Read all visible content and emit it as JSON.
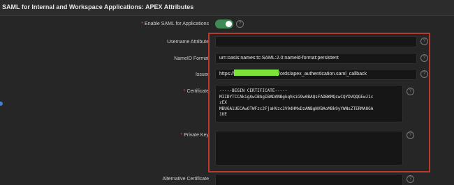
{
  "header": {
    "title": "SAML for Internal and Workspace Applications: APEX Attributes"
  },
  "form": {
    "enable_saml": {
      "label": "Enable SAML for Applications",
      "required_mark": "*",
      "state": "on"
    },
    "username_attribute": {
      "label": "Username Attribute",
      "value": ""
    },
    "nameid_format": {
      "label": "NameID Format",
      "value": "urn:oasis:names:tc:SAML:2.0:nameid-format:persistent"
    },
    "issuer": {
      "label": "Issuer",
      "prefix": "https://",
      "suffix": "/ords/apex_authentication.saml_callback"
    },
    "certificate": {
      "label": "Certificate",
      "required_mark": "*",
      "lines": [
        "-----BEGIN CERTIFICATE-----",
        "MIIDYTCCAkigAwIBAgIBADANBgkqhkiG9w0BAQsFADBKMQswCQYDVQQGEwJ1c",
        "zEX",
        "MBUGA1UECAwOTWFzc2FjaHVzc2V0dHMxDzANBgNVBAoMBk9yYWNsZTERMA8GA",
        "1UE"
      ]
    },
    "private_key": {
      "label": "Private Key",
      "required_mark": "*",
      "value": ""
    },
    "alternative_certificate": {
      "label": "Alternative Certificate",
      "value": ""
    }
  },
  "icons": {
    "help_glyph": "?"
  },
  "colors": {
    "toggle_on": "#3f8a55",
    "highlight_border": "#b83a2c",
    "redaction": "#7ee33a",
    "required": "#e0503f"
  }
}
